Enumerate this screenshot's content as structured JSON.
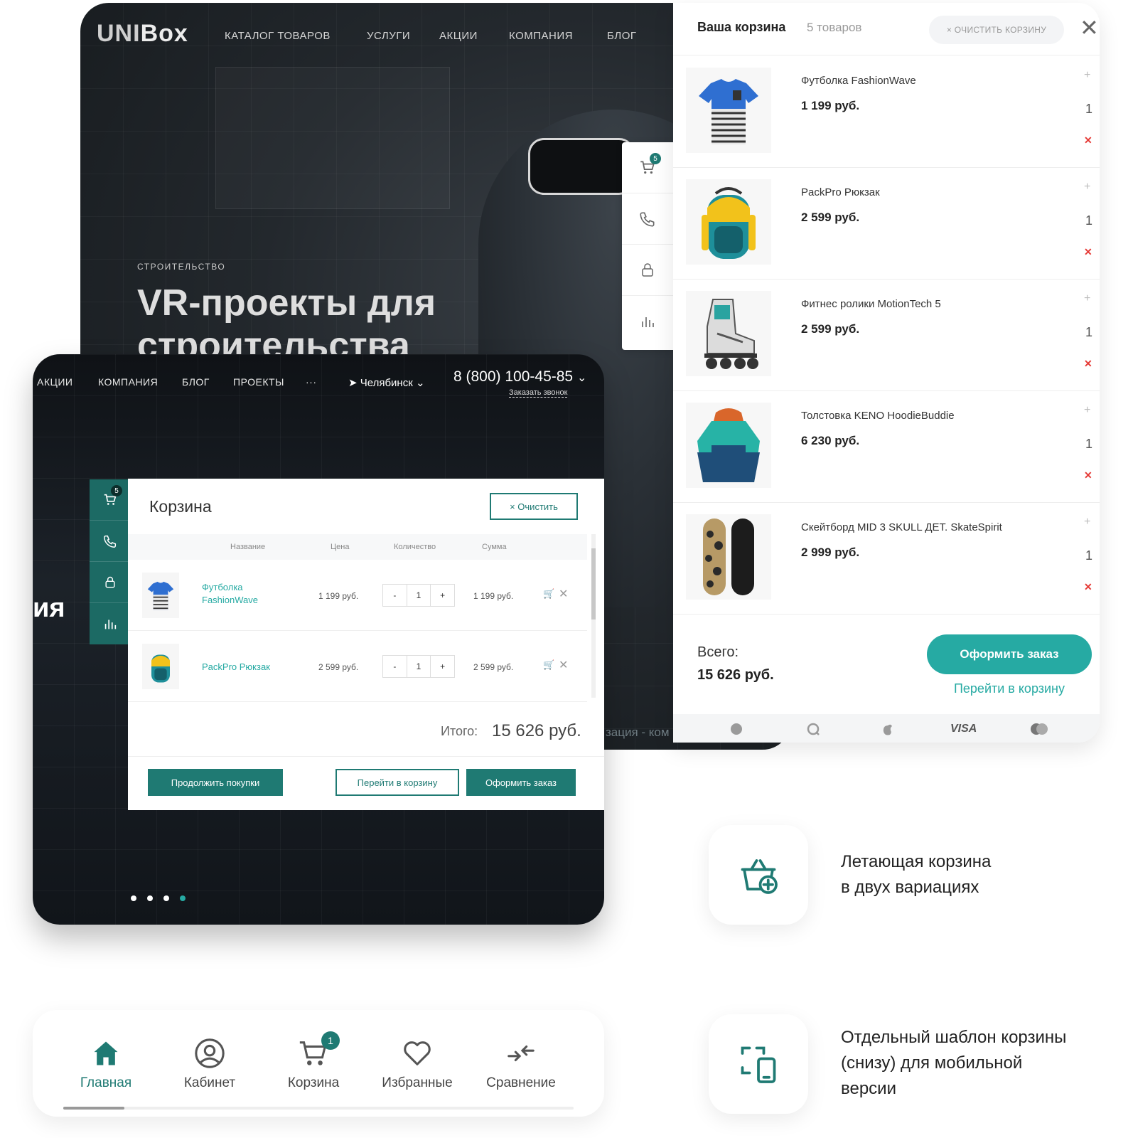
{
  "hero": {
    "logo_a": "UNI",
    "logo_b": "Box",
    "nav": [
      "КАТАЛОГ ТОВАРОВ",
      "УСЛУГИ",
      "АКЦИИ",
      "КОМПАНИЯ",
      "БЛОГ"
    ],
    "kicker": "СТРОИТЕЛЬСТВО",
    "title": "VR-проекты для строительства",
    "sidebar_badge": "5"
  },
  "cart_panel": {
    "title": "Ваша корзина",
    "count": "5 товаров",
    "clear_label": "× ОЧИСТИТЬ КОРЗИНУ",
    "close_label": "✕",
    "items": [
      {
        "name": "Футболка FashionWave",
        "price": "1 199 руб.",
        "qty": "1"
      },
      {
        "name": "PackPro Рюкзак",
        "price": "2 599 руб.",
        "qty": "1"
      },
      {
        "name": "Фитнес ролики MotionTech 5",
        "price": "2 599 руб.",
        "qty": "1"
      },
      {
        "name": "Толстовка KENO HoodieBuddie",
        "price": "6 230 руб.",
        "qty": "1"
      },
      {
        "name": "Скейтборд MID 3 SKULL ДЕТ. SkateSpirit",
        "price": "2 999 руб.",
        "qty": "1"
      }
    ],
    "total_label": "Всего:",
    "total": "15 626 руб.",
    "order_button": "Оформить заказ",
    "go_cart_link": "Перейти в корзину",
    "payment": [
      "VISA"
    ]
  },
  "front": {
    "nav": [
      "АКЦИИ",
      "КОМПАНИЯ",
      "БЛОГ",
      "ПРОЕКТЫ",
      "···"
    ],
    "city": "Челябинск",
    "phone": "8 (800) 100-45-85",
    "callback": "Заказать звонок",
    "hero_fragment": "ия",
    "sidebar_badge": "5",
    "side_text": "зация - ком"
  },
  "modal": {
    "title": "Корзина",
    "clear_label": "× Очистить",
    "headers": {
      "name": "Название",
      "price": "Цена",
      "qty": "Количество",
      "sum": "Сумма"
    },
    "rows": [
      {
        "name": "Футболка FashionWave",
        "price": "1 199 руб.",
        "qty": "1",
        "sum": "1 199 руб."
      },
      {
        "name": "PackPro Рюкзак",
        "price": "2 599 руб.",
        "qty": "1",
        "sum": "2 599 руб."
      }
    ],
    "total_label": "Итого:",
    "total": "15 626 руб.",
    "continue_button": "Продолжить покупки",
    "go_cart_button": "Перейти в корзину",
    "order_button": "Оформить заказ"
  },
  "features": [
    {
      "text_1": "Летающая корзина",
      "text_2": "в двух вариациях"
    },
    {
      "text_1": "Отдельный шаблон корзины",
      "text_2": "(снизу) для мобильной",
      "text_3": "версии"
    }
  ],
  "mobile_bar": {
    "tabs": [
      "Главная",
      "Кабинет",
      "Корзина",
      "Избранные",
      "Сравнение"
    ],
    "cart_badge": "1"
  },
  "colors": {
    "accent": "#26aaa3",
    "dark_accent": "#1f7a73",
    "delete": "#e53935"
  }
}
